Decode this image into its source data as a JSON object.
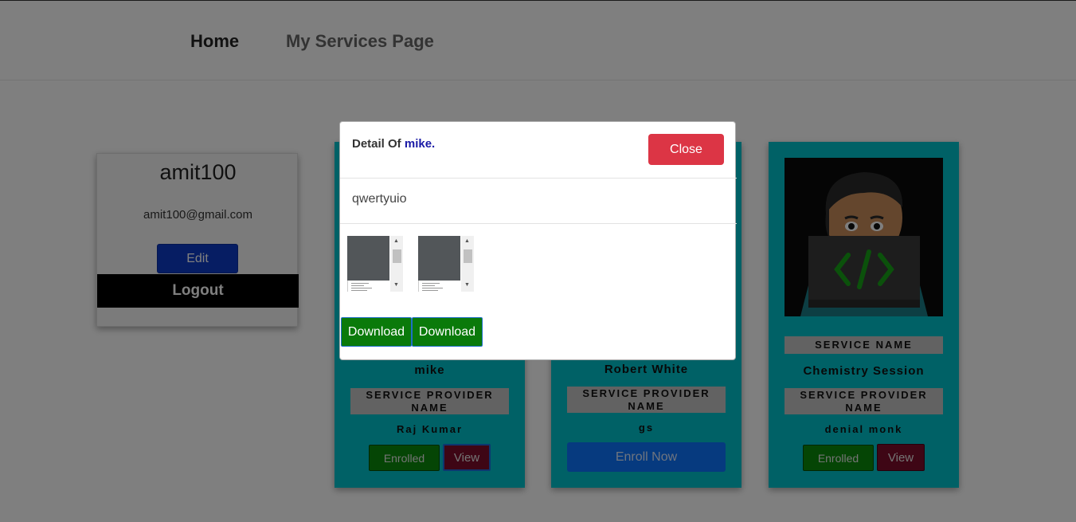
{
  "nav": {
    "home_label": "Home",
    "services_label": "My Services Page"
  },
  "profile": {
    "username": "amit100",
    "email": "amit100@gmail.com",
    "edit_label": "Edit",
    "logout_label": "Logout"
  },
  "cards": [
    {
      "service_name": "mike",
      "provider_label": "SERVICE PROVIDER NAME",
      "provider_name": "Raj Kumar",
      "enrolled_label": "Enrolled",
      "view_label": "View"
    },
    {
      "service_name": "Robert White",
      "provider_label": "SERVICE PROVIDER NAME",
      "provider_name": "gs",
      "enroll_label": "Enroll Now"
    },
    {
      "service_label": "SERVICE NAME",
      "service_name": "Chemistry Session",
      "provider_label": "SERVICE PROVIDER NAME",
      "provider_name": "denial monk",
      "enrolled_label": "Enrolled",
      "view_label": "View"
    }
  ],
  "modal": {
    "title_prefix": "Detail Of",
    "title_name": "mike.",
    "close_label": "Close",
    "description": "qwertyuio",
    "download_labels": [
      "Download",
      "Download"
    ]
  },
  "colors": {
    "card_bg": "#00c2cc",
    "enrolled_green": "#0a8a0a",
    "view_maroon": "#7d0d2b",
    "enroll_blue": "#0d74ff",
    "close_red": "#dc3545",
    "edit_blue": "#0d3bc7",
    "overlay": "rgba(0,0,0,0.5)"
  },
  "icons": {
    "coder_image": "developer-avatar-illustration",
    "code_symbol": "code-brackets-icon"
  }
}
